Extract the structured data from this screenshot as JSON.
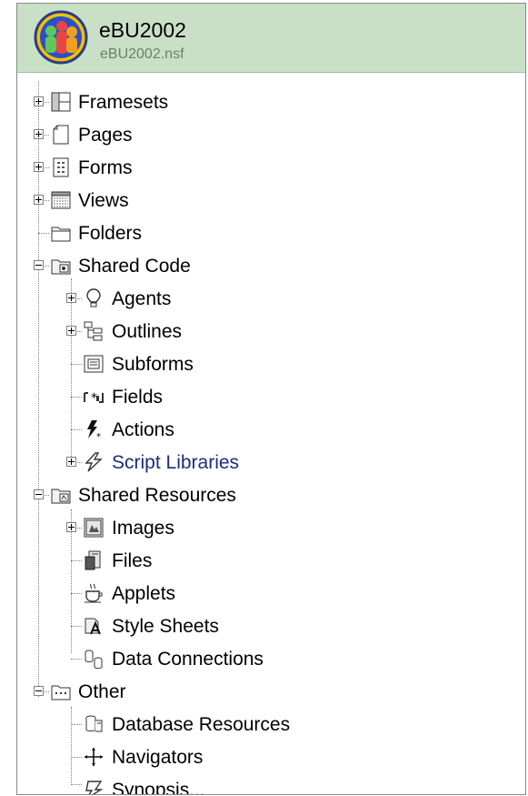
{
  "header": {
    "title": "eBU2002",
    "filename": "eBU2002.nsf"
  },
  "tree": {
    "framesets": "Framesets",
    "pages": "Pages",
    "forms": "Forms",
    "views": "Views",
    "folders": "Folders",
    "shared_code": {
      "label": "Shared Code",
      "agents": "Agents",
      "outlines": "Outlines",
      "subforms": "Subforms",
      "fields": "Fields",
      "actions": "Actions",
      "script_libraries": "Script Libraries"
    },
    "shared_resources": {
      "label": "Shared Resources",
      "images": "Images",
      "files": "Files",
      "applets": "Applets",
      "style_sheets": "Style Sheets",
      "data_connections": "Data Connections"
    },
    "other": {
      "label": "Other",
      "database_resources": "Database Resources",
      "navigators": "Navigators",
      "synopsis": "Synopsis..."
    }
  },
  "colors": {
    "header_bg": "#c9e0c6",
    "link": "#1c2d7a",
    "tree_line": "#808080"
  }
}
